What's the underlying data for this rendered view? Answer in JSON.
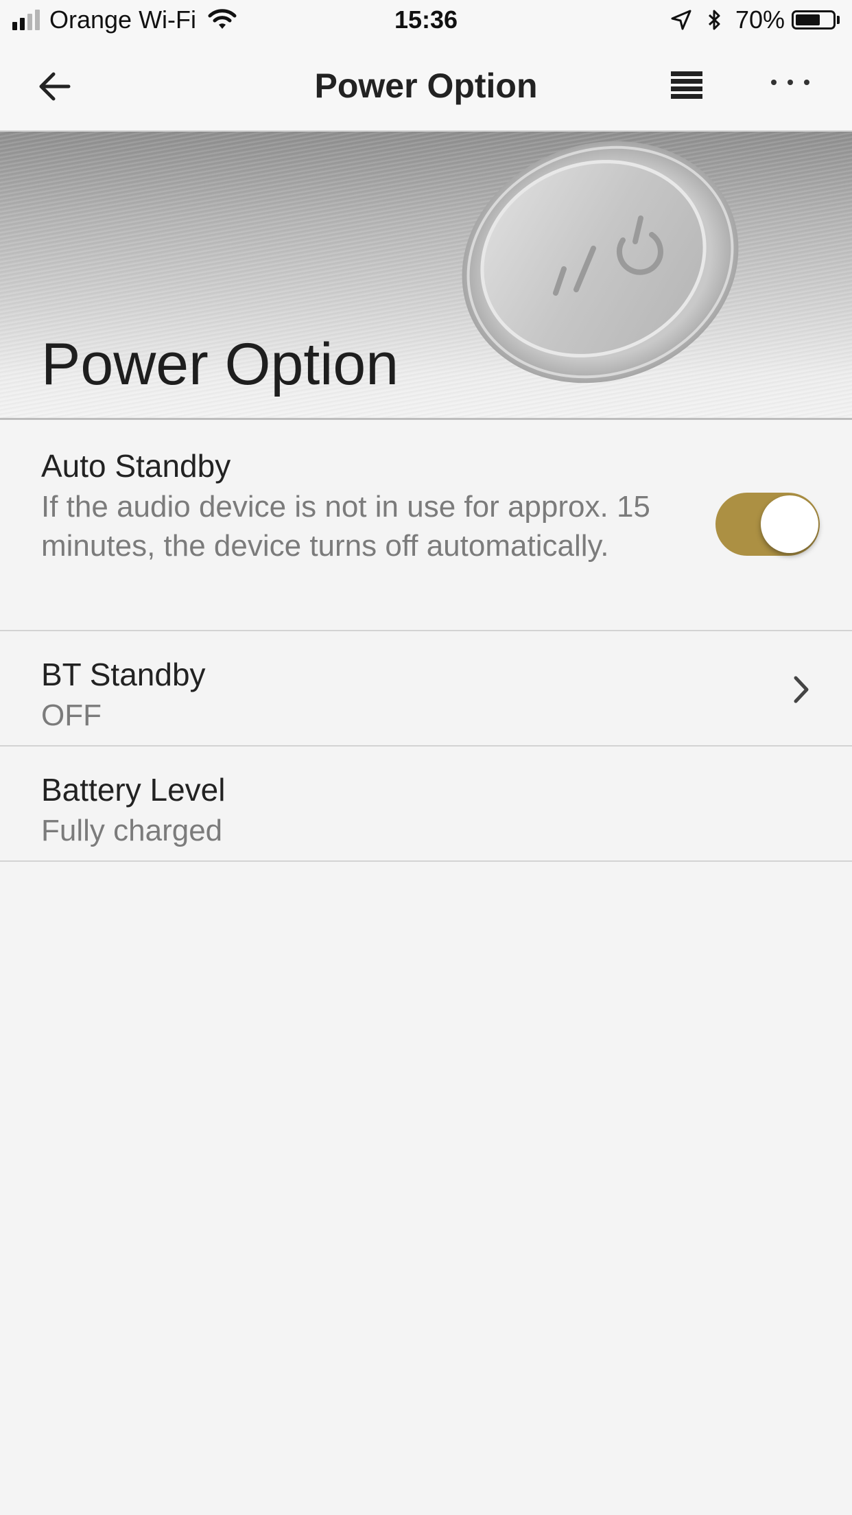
{
  "status_bar": {
    "carrier": "Orange Wi-Fi",
    "time": "15:36",
    "battery_percent": "70%",
    "battery_level": 0.7,
    "signal_bars_active": 2,
    "signal_bars_total": 4
  },
  "app_bar": {
    "title": "Power Option",
    "back_icon": "arrow-left-icon",
    "queue_icon": "queue-list-icon",
    "more_icon": "more-horizontal-icon"
  },
  "hero": {
    "title": "Power Option",
    "image": "power-button-icon"
  },
  "settings": {
    "auto_standby": {
      "label": "Auto Standby",
      "description": "If the audio device is not in use for approx. 15 minutes, the device turns off automatically.",
      "enabled": true
    },
    "bt_standby": {
      "label": "BT Standby",
      "value": "OFF"
    },
    "battery_level": {
      "label": "Battery Level",
      "value": "Fully charged"
    }
  },
  "colors": {
    "accent": "#ac9043",
    "background": "#f4f4f4",
    "divider": "#d3d3d3",
    "secondary_text": "#7b7b7b"
  }
}
